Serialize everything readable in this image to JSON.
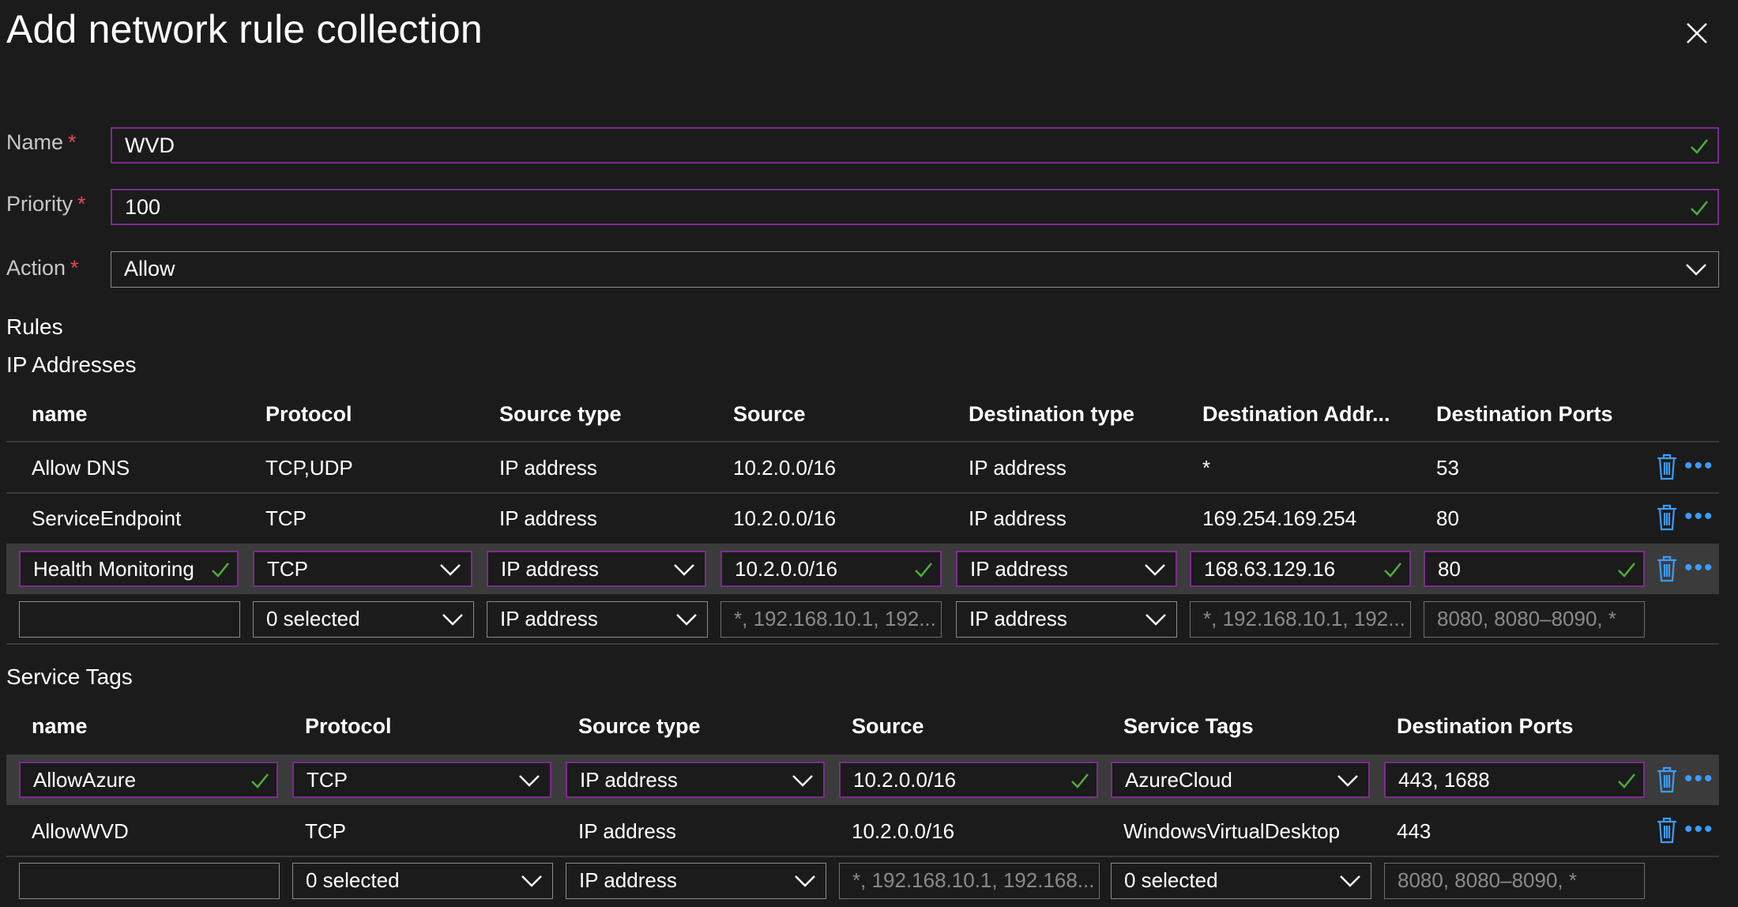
{
  "title": "Add network rule collection",
  "form": {
    "name_label": "Name",
    "name_value": "WVD",
    "priority_label": "Priority",
    "priority_value": "100",
    "action_label": "Action",
    "action_value": "Allow",
    "required_mark": "*"
  },
  "rules_heading": "Rules",
  "ip_section": {
    "heading": "IP Addresses",
    "headers": [
      "name",
      "Protocol",
      "Source type",
      "Source",
      "Destination type",
      "Destination Addr...",
      "Destination Ports"
    ],
    "rows": [
      [
        "Allow DNS",
        "TCP,UDP",
        "IP address",
        "10.2.0.0/16",
        "IP address",
        "*",
        "53"
      ],
      [
        "ServiceEndpoint",
        "TCP",
        "IP address",
        "10.2.0.0/16",
        "IP address",
        "169.254.169.254",
        "80"
      ]
    ],
    "edit_row": [
      "Health Monitoring",
      "TCP",
      "IP address",
      "10.2.0.0/16",
      "IP address",
      "168.63.129.16",
      "80"
    ],
    "new_row": {
      "name": "",
      "protocol": "0 selected",
      "source_type": "IP address",
      "source_placeholder": "*, 192.168.10.1, 192...",
      "dest_type": "IP address",
      "dest_placeholder": "*, 192.168.10.1, 192...",
      "ports_placeholder": "8080, 8080–8090, *"
    }
  },
  "tags_section": {
    "heading": "Service Tags",
    "headers": [
      "name",
      "Protocol",
      "Source type",
      "Source",
      "Service Tags",
      "Destination Ports"
    ],
    "edit_row": [
      "AllowAzure",
      "TCP",
      "IP address",
      "10.2.0.0/16",
      "AzureCloud",
      "443, 1688"
    ],
    "rows": [
      [
        "AllowWVD",
        "TCP",
        "IP address",
        "10.2.0.0/16",
        "WindowsVirtualDesktop",
        "443"
      ]
    ],
    "new_row": {
      "name": "",
      "protocol": "0 selected",
      "source_type": "IP address",
      "source_placeholder": "*, 192.168.10.1, 192.168...",
      "service_tags": "0 selected",
      "ports_placeholder": "8080, 8080–8090, *"
    }
  },
  "icons": {
    "close": "close-icon",
    "check": "checkmark-icon",
    "chevron": "chevron-down-icon",
    "delete": "trash-icon",
    "more": "more-icon"
  },
  "colors": {
    "background": "#1b1b1b",
    "accent_border": "#7b2c8c",
    "required": "#e5484d",
    "check": "#4fae3b",
    "link_blue": "#3b9cff",
    "selected_row": "#3b3b3b"
  }
}
